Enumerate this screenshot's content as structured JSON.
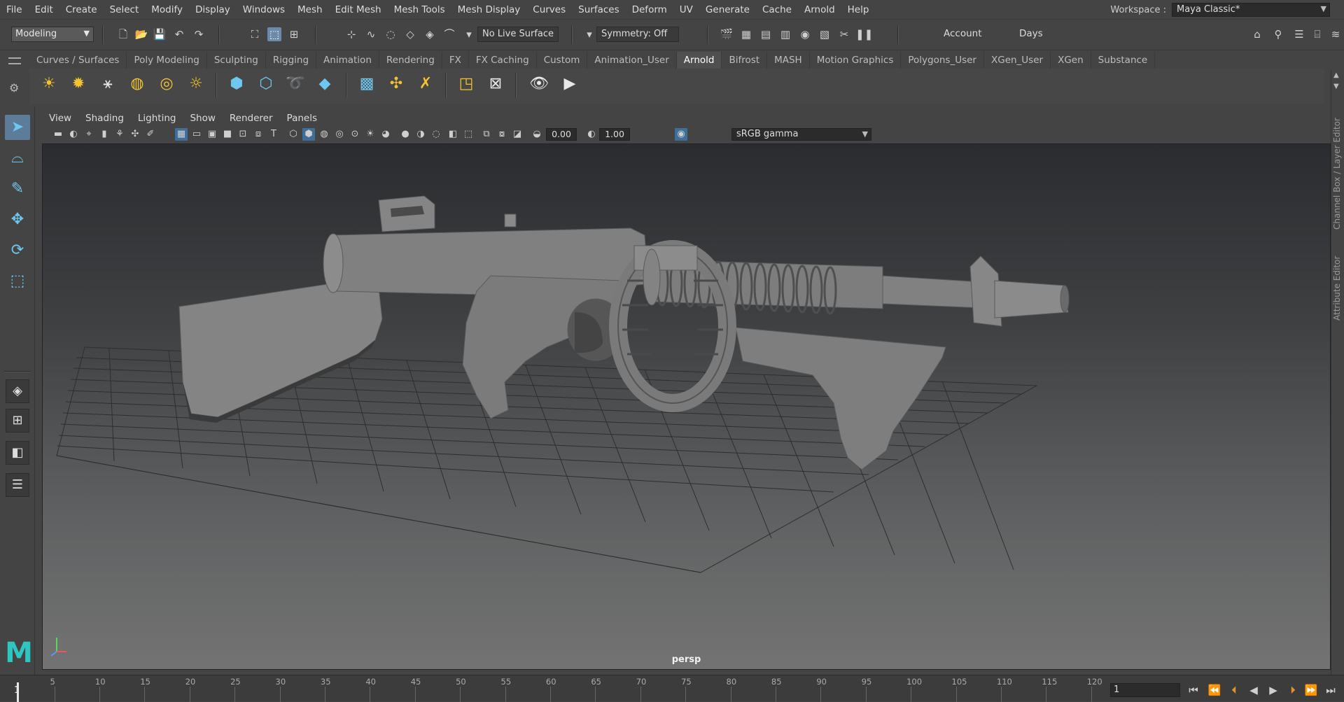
{
  "menubar": {
    "items": [
      "File",
      "Edit",
      "Create",
      "Select",
      "Modify",
      "Display",
      "Windows",
      "Mesh",
      "Edit Mesh",
      "Mesh Tools",
      "Mesh Display",
      "Curves",
      "Surfaces",
      "Deform",
      "UV",
      "Generate",
      "Cache",
      "Arnold",
      "Help"
    ],
    "workspace_label": "Workspace :",
    "workspace_value": "Maya Classic*"
  },
  "statusline": {
    "mode": "Modeling",
    "live_surface": "No Live Surface",
    "symmetry": "Symmetry: Off",
    "account": "Account",
    "days": "Days"
  },
  "shelf": {
    "tabs": [
      "Curves / Surfaces",
      "Poly Modeling",
      "Sculpting",
      "Rigging",
      "Animation",
      "Rendering",
      "FX",
      "FX Caching",
      "Custom",
      "Animation_User",
      "Arnold",
      "Bifrost",
      "MASH",
      "Motion Graphics",
      "Polygons_User",
      "XGen_User",
      "XGen",
      "Substance"
    ],
    "active_tab": "Arnold"
  },
  "panel": {
    "menus": [
      "View",
      "Shading",
      "Lighting",
      "Show",
      "Renderer",
      "Panels"
    ],
    "exposure": "0.00",
    "gamma": "1.00",
    "color_space": "sRGB gamma",
    "camera": "persp"
  },
  "right_tabs": {
    "channel_box": "Channel Box / Layer Editor",
    "attribute_editor": "Attribute Editor"
  },
  "timeslider": {
    "ticks": [
      "1",
      "5",
      "10",
      "15",
      "20",
      "25",
      "30",
      "35",
      "40",
      "45",
      "50",
      "55",
      "60",
      "65",
      "70",
      "75",
      "80",
      "85",
      "90",
      "95",
      "100",
      "105",
      "110",
      "115",
      "120"
    ],
    "current_frame": "1"
  },
  "colors": {
    "accent": "#5d7c9a",
    "maya_logo": "#2ec6c0",
    "viewport_top": "#2a2c2f",
    "viewport_bottom": "#737373"
  }
}
